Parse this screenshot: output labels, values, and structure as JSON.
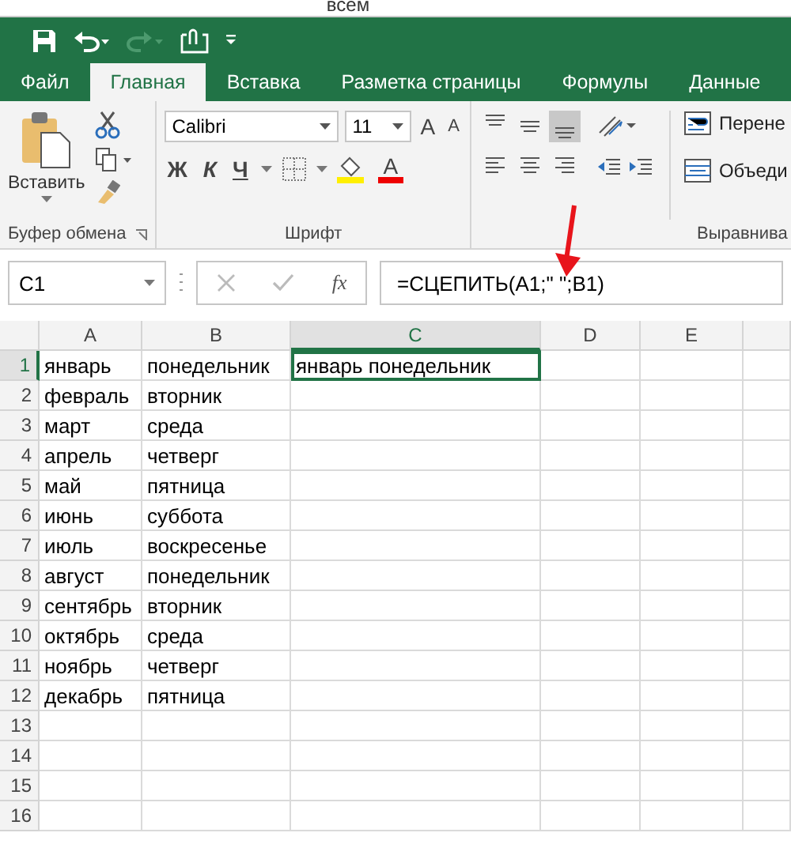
{
  "top_strip": {
    "text": "всем"
  },
  "tabs": [
    {
      "label": "Файл",
      "selected": false
    },
    {
      "label": "Главная",
      "selected": true
    },
    {
      "label": "Вставка",
      "selected": false
    },
    {
      "label": "Разметка страницы",
      "selected": false
    },
    {
      "label": "Формулы",
      "selected": false
    },
    {
      "label": "Данные",
      "selected": false
    }
  ],
  "ribbon": {
    "clipboard": {
      "paste_label": "Вставить",
      "group_label": "Буфер обмена"
    },
    "font": {
      "font_name": "Calibri",
      "font_size": "11",
      "grow_font": "A",
      "shrink_font": "A",
      "bold": "Ж",
      "italic": "К",
      "underline": "Ч",
      "font_color": "A",
      "group_label": "Шрифт"
    },
    "alignment": {
      "wrap_label": "Перене",
      "merge_label": "Объеди",
      "group_label": "Выравнива"
    }
  },
  "formula_bar": {
    "name_box": "C1",
    "function_label": "fx",
    "formula": "=СЦЕПИТЬ(A1;\" \";B1)"
  },
  "sheet": {
    "columns": [
      {
        "label": "A",
        "selected": false
      },
      {
        "label": "B",
        "selected": false
      },
      {
        "label": "C",
        "selected": true
      },
      {
        "label": "D",
        "selected": false
      },
      {
        "label": "E",
        "selected": false
      }
    ],
    "rows": [
      {
        "label": "1",
        "selected": true,
        "cells": [
          {
            "text": "январь",
            "selected": false
          },
          {
            "text": "понедельник",
            "selected": false
          },
          {
            "text": "январь понедельник",
            "selected": true
          }
        ]
      },
      {
        "label": "2",
        "selected": false,
        "cells": [
          {
            "text": "февраль",
            "selected": false
          },
          {
            "text": "вторник",
            "selected": false
          }
        ]
      },
      {
        "label": "3",
        "selected": false,
        "cells": [
          {
            "text": "март",
            "selected": false
          },
          {
            "text": "среда",
            "selected": false
          }
        ]
      },
      {
        "label": "4",
        "selected": false,
        "cells": [
          {
            "text": "апрель",
            "selected": false
          },
          {
            "text": "четверг",
            "selected": false
          }
        ]
      },
      {
        "label": "5",
        "selected": false,
        "cells": [
          {
            "text": "май",
            "selected": false
          },
          {
            "text": "пятница",
            "selected": false
          }
        ]
      },
      {
        "label": "6",
        "selected": false,
        "cells": [
          {
            "text": "июнь",
            "selected": false
          },
          {
            "text": "суббота",
            "selected": false
          }
        ]
      },
      {
        "label": "7",
        "selected": false,
        "cells": [
          {
            "text": "июль",
            "selected": false
          },
          {
            "text": "воскресенье",
            "selected": false
          }
        ]
      },
      {
        "label": "8",
        "selected": false,
        "cells": [
          {
            "text": "август",
            "selected": false
          },
          {
            "text": "понедельник",
            "selected": false
          }
        ]
      },
      {
        "label": "9",
        "selected": false,
        "cells": [
          {
            "text": "сентябрь",
            "selected": false
          },
          {
            "text": "вторник",
            "selected": false
          }
        ]
      },
      {
        "label": "10",
        "selected": false,
        "cells": [
          {
            "text": "октябрь",
            "selected": false
          },
          {
            "text": "среда",
            "selected": false
          }
        ]
      },
      {
        "label": "11",
        "selected": false,
        "cells": [
          {
            "text": "ноябрь",
            "selected": false
          },
          {
            "text": "четверг",
            "selected": false
          }
        ]
      },
      {
        "label": "12",
        "selected": false,
        "cells": [
          {
            "text": "декабрь",
            "selected": false
          },
          {
            "text": "пятница",
            "selected": false
          }
        ]
      },
      {
        "label": "13",
        "selected": false
      },
      {
        "label": "14",
        "selected": false
      },
      {
        "label": "15",
        "selected": false
      },
      {
        "label": "16",
        "selected": false
      }
    ]
  }
}
